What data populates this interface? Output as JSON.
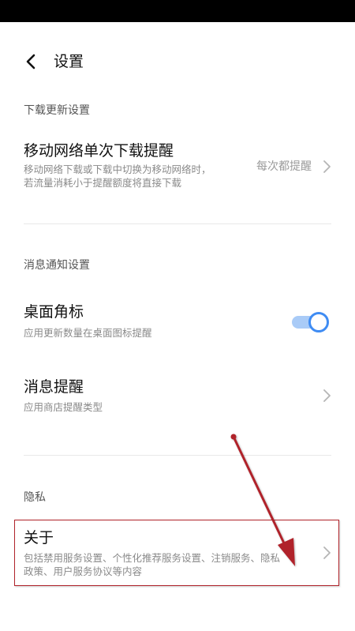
{
  "header": {
    "title": "设置"
  },
  "sections": {
    "download": {
      "title": "下载更新设置",
      "item": {
        "title": "移动网络单次下载提醒",
        "subtitle_line1": "移动网络下载或下载中切换为移动网络时，",
        "subtitle_line2": "若流量消耗小于提醒额度将直接下载",
        "value": "每次都提醒"
      }
    },
    "notifications": {
      "title": "消息通知设置",
      "badge": {
        "title": "桌面角标",
        "subtitle": "应用更新数量在桌面图标提醒",
        "enabled": true
      },
      "reminder": {
        "title": "消息提醒",
        "subtitle": "应用商店提醒类型"
      }
    },
    "privacy": {
      "title": "隐私",
      "about": {
        "title": "关于",
        "subtitle_line1": "包括禁用服务设置、个性化推荐服务设置、注销服务、隐私",
        "subtitle_line2": "政策、用户服务协议等内容"
      }
    }
  },
  "colors": {
    "accent": "#3f8cf3",
    "annotation": "#b0232a"
  }
}
